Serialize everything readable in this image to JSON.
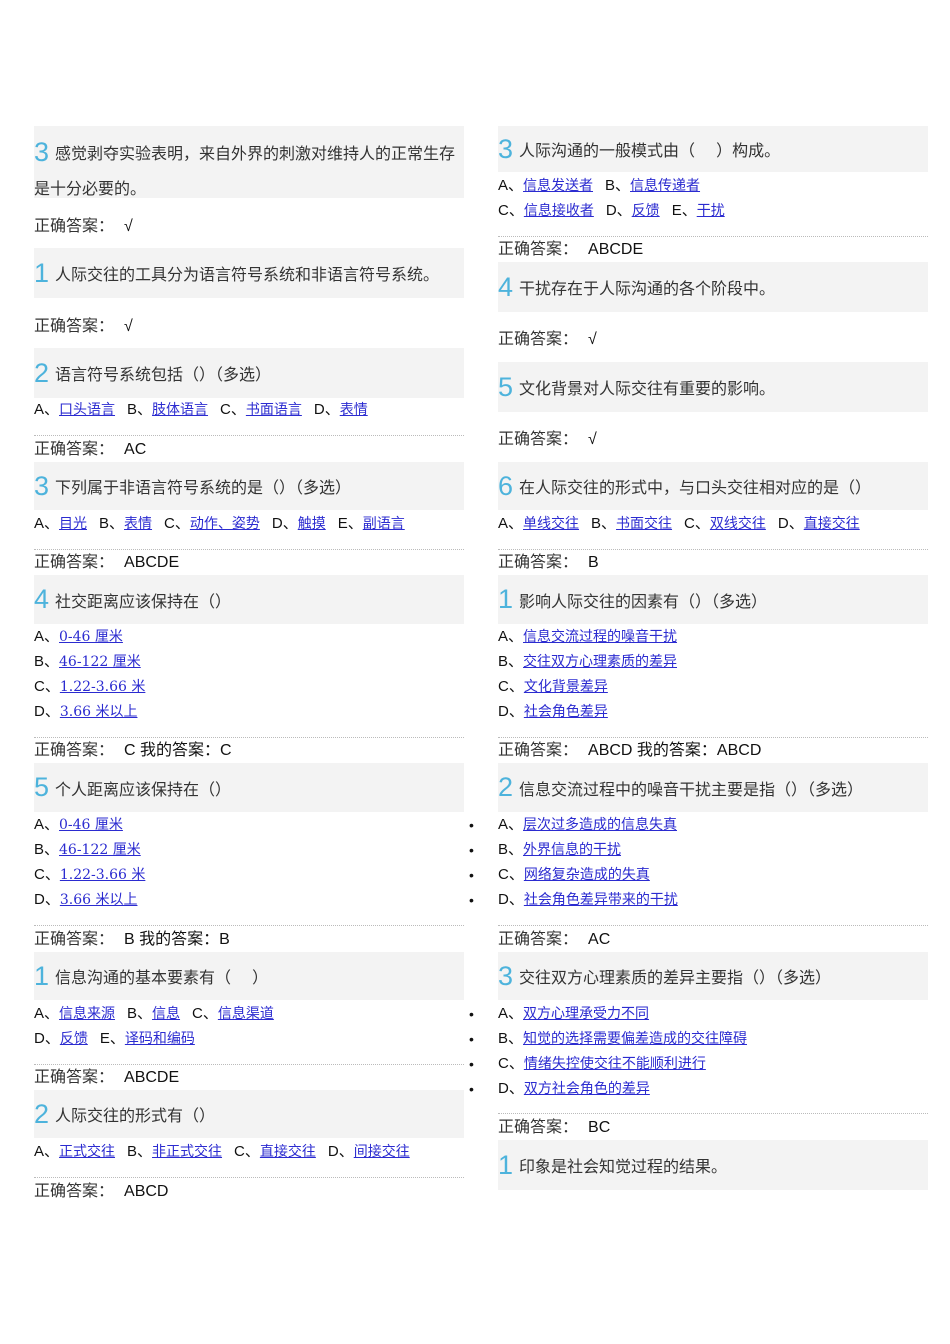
{
  "left": {
    "blocks": [
      {
        "type": "q",
        "num": "3",
        "text": "感觉剥夺实验表明，来自外界的刺激对维持人的正常生存是十分必要的。"
      },
      {
        "type": "ans",
        "label": "正确答案：",
        "value": "√"
      },
      {
        "type": "q",
        "num": "1",
        "text": "人际交往的工具分为语言符号系统和非语言符号系统。"
      },
      {
        "type": "ans",
        "label": "正确答案：",
        "value": "√"
      },
      {
        "type": "q",
        "num": "2",
        "text": "语言符号系统包括（）（多选）"
      },
      {
        "type": "opt",
        "rows": [
          [
            {
              "letter": "A、",
              "text": "口头语言"
            },
            {
              "letter": "B、",
              "text": "肢体语言"
            },
            {
              "letter": "C、",
              "text": "书面语言"
            },
            {
              "letter": "D、",
              "text": "表情"
            }
          ]
        ]
      },
      {
        "type": "ans",
        "label": "正确答案：",
        "value": "AC"
      },
      {
        "type": "q",
        "num": "3",
        "text": "下列属于非语言符号系统的是（）（多选）"
      },
      {
        "type": "opt",
        "rows": [
          [
            {
              "letter": "A、",
              "text": "目光"
            },
            {
              "letter": "B、",
              "text": "表情"
            },
            {
              "letter": "C、",
              "text": "动作、姿势"
            },
            {
              "letter": "D、",
              "text": "触摸"
            },
            {
              "letter": "E、",
              "text": "副语言"
            }
          ]
        ]
      },
      {
        "type": "ans",
        "label": "正确答案：",
        "value": "ABCDE"
      },
      {
        "type": "q",
        "num": "4",
        "text": "社交距离应该保持在（）"
      },
      {
        "type": "opt",
        "rows": [
          [
            {
              "letter": "A、",
              "text": "0-46 厘米"
            }
          ],
          [
            {
              "letter": "B、",
              "text": "46-122 厘米"
            }
          ],
          [
            {
              "letter": "C、",
              "text": "1.22-3.66 米"
            }
          ],
          [
            {
              "letter": "D、",
              "text": "3.66 米以上"
            }
          ]
        ]
      },
      {
        "type": "ans",
        "label": "正确答案：",
        "value": "C 我的答案：C"
      },
      {
        "type": "q",
        "num": "5",
        "text": "个人距离应该保持在（）"
      },
      {
        "type": "opt",
        "rows": [
          [
            {
              "letter": "A、",
              "text": "0-46 厘米"
            }
          ],
          [
            {
              "letter": "B、",
              "text": "46-122 厘米"
            }
          ],
          [
            {
              "letter": "C、",
              "text": "1.22-3.66 米"
            }
          ],
          [
            {
              "letter": "D、",
              "text": "3.66 米以上"
            }
          ]
        ]
      },
      {
        "type": "ans",
        "label": "正确答案：",
        "value": "B 我的答案：B"
      },
      {
        "type": "q",
        "num": "1",
        "text": "信息沟通的基本要素有（　 ）"
      },
      {
        "type": "opt",
        "rows": [
          [
            {
              "letter": "A、",
              "text": "信息来源"
            },
            {
              "letter": "B、",
              "text": "信息"
            },
            {
              "letter": "C、",
              "text": "信息渠道"
            }
          ],
          [
            {
              "letter": "D、",
              "text": "反馈"
            },
            {
              "letter": "E、",
              "text": "译码和编码"
            }
          ]
        ]
      },
      {
        "type": "ans",
        "label": "正确答案：",
        "value": "ABCDE"
      },
      {
        "type": "q",
        "num": "2",
        "text": "人际交往的形式有（）"
      },
      {
        "type": "opt",
        "rows": [
          [
            {
              "letter": "A、",
              "text": "正式交往"
            },
            {
              "letter": "B、",
              "text": "非正式交往"
            },
            {
              "letter": "C、",
              "text": "直接交往"
            },
            {
              "letter": "D、",
              "text": "间接交往"
            }
          ]
        ]
      },
      {
        "type": "ans",
        "label": "正确答案：",
        "value": "ABCD"
      }
    ]
  },
  "right": {
    "blocks": [
      {
        "type": "q",
        "num": "3",
        "text": "人际沟通的一般模式由（　 ）构成。"
      },
      {
        "type": "opt",
        "rows": [
          [
            {
              "letter": "A、",
              "text": "信息发送者"
            },
            {
              "letter": "B、",
              "text": "信息传递者"
            }
          ],
          [
            {
              "letter": "C、",
              "text": "信息接收者"
            },
            {
              "letter": "D、",
              "text": "反馈"
            },
            {
              "letter": "E、",
              "text": "干扰"
            }
          ]
        ]
      },
      {
        "type": "ans",
        "label": "正确答案：",
        "value": "ABCDE"
      },
      {
        "type": "q",
        "num": "4",
        "text": "干扰存在于人际沟通的各个阶段中。"
      },
      {
        "type": "ans",
        "label": "正确答案：",
        "value": "√"
      },
      {
        "type": "q",
        "num": "5",
        "text": "文化背景对人际交往有重要的影响。"
      },
      {
        "type": "ans",
        "label": "正确答案：",
        "value": "√"
      },
      {
        "type": "q",
        "num": "6",
        "text": "在人际交往的形式中，与口头交往相对应的是（）"
      },
      {
        "type": "opt",
        "rows": [
          [
            {
              "letter": "A、",
              "text": "单线交往"
            },
            {
              "letter": "B、",
              "text": "书面交往"
            },
            {
              "letter": "C、",
              "text": "双线交往"
            },
            {
              "letter": "D、",
              "text": "直接交往"
            }
          ]
        ]
      },
      {
        "type": "ans",
        "label": "正确答案：",
        "value": "B"
      },
      {
        "type": "q",
        "num": "1",
        "text": "影响人际交往的因素有（）（多选）"
      },
      {
        "type": "opt",
        "rows": [
          [
            {
              "letter": "A、",
              "text": "信息交流过程的噪音干扰"
            }
          ],
          [
            {
              "letter": "B、",
              "text": "交往双方心理素质的差异"
            }
          ],
          [
            {
              "letter": "C、",
              "text": "文化背景差异"
            }
          ],
          [
            {
              "letter": "D、",
              "text": "社会角色差异"
            }
          ]
        ]
      },
      {
        "type": "ans",
        "label": "正确答案：",
        "value": "ABCD 我的答案：ABCD"
      },
      {
        "type": "q",
        "num": "2",
        "text": "信息交流过程中的噪音干扰主要是指（）（多选）"
      },
      {
        "type": "opt",
        "bullets": true,
        "rows": [
          [
            {
              "letter": "A、",
              "text": "层次过多造成的信息失真"
            }
          ],
          [
            {
              "letter": "B、",
              "text": "外界信息的干扰"
            }
          ],
          [
            {
              "letter": "C、",
              "text": "网络复杂造成的失真"
            }
          ],
          [
            {
              "letter": "D、",
              "text": "社会角色差异带来的干扰"
            }
          ]
        ]
      },
      {
        "type": "ans",
        "label": "正确答案：",
        "value": "AC"
      },
      {
        "type": "q",
        "num": "3",
        "text": "交往双方心理素质的差异主要指（）（多选）"
      },
      {
        "type": "opt",
        "bullets": true,
        "rows": [
          [
            {
              "letter": "A、",
              "text": "双方心理承受力不同"
            }
          ],
          [
            {
              "letter": "B、",
              "text": "知觉的选择需要偏差造成的交往障碍"
            }
          ],
          [
            {
              "letter": "C、",
              "text": "情绪失控使交往不能顺利进行"
            }
          ],
          [
            {
              "letter": "D、",
              "text": "双方社会角色的差异"
            }
          ]
        ]
      },
      {
        "type": "ans",
        "label": "正确答案：",
        "value": "BC"
      },
      {
        "type": "q",
        "num": "1",
        "text": "印象是社会知觉过程的结果。"
      }
    ]
  },
  "colors": {
    "number": "#4db3dc",
    "link": "#2b2bd0",
    "question_bg": "#f3f3f3"
  }
}
